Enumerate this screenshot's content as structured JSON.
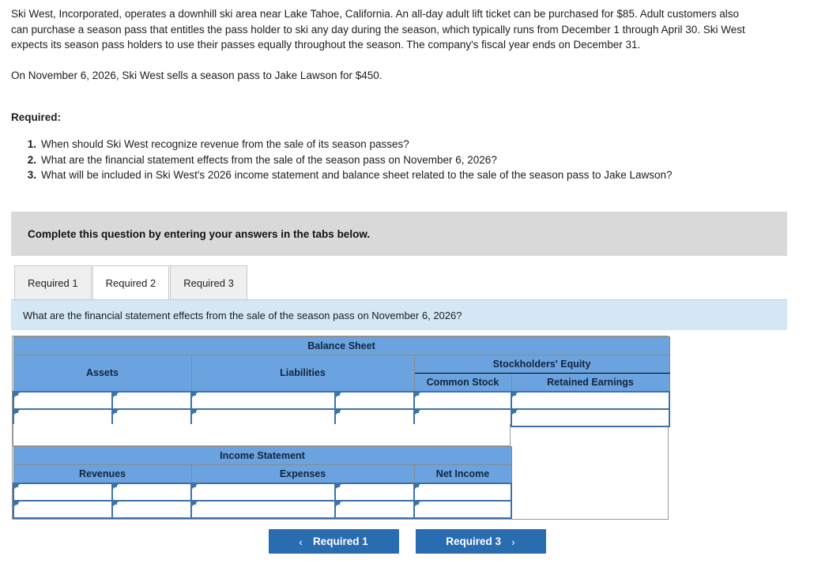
{
  "problem": {
    "paragraph1": "Ski West, Incorporated, operates a downhill ski area near Lake Tahoe, California. An all-day adult lift ticket can be purchased for $85. Adult customers also can purchase a season pass that entitles the pass holder to ski any day during the season, which typically runs from December 1 through April 30. Ski West expects its season pass holders to use their passes equally throughout the season. The company's fiscal year ends on December 31.",
    "paragraph2": "On November 6, 2026, Ski West sells a season pass to Jake Lawson for $450.",
    "required_label": "Required:",
    "requirements": [
      {
        "num": "1.",
        "text": "When should Ski West recognize revenue from the sale of its season passes?"
      },
      {
        "num": "2.",
        "text": "What are the financial statement effects from the sale of the season pass on November 6, 2026?"
      },
      {
        "num": "3.",
        "text": "What will be included in Ski West's 2026 income statement and balance sheet related to the sale of the season pass to Jake Lawson?"
      }
    ]
  },
  "instruction_bar": {
    "text": "Complete this question by entering your answers in the tabs below."
  },
  "tabs": [
    {
      "label": "Required 1",
      "active": false
    },
    {
      "label": "Required 2",
      "active": true
    },
    {
      "label": "Required 3",
      "active": false
    }
  ],
  "question_banner": {
    "text": "What are the financial statement effects from the sale of the season pass on November 6, 2026?"
  },
  "worksheet": {
    "balance_sheet": {
      "title": "Balance Sheet",
      "columns": [
        "Assets",
        "Liabilities",
        "Stockholders' Equity"
      ],
      "equity_subcolumns": [
        "Common Stock",
        "Retained Earnings"
      ],
      "rows": [
        {
          "assets_label": "",
          "assets_amount": "",
          "liabilities_label": "",
          "liabilities_amount": "",
          "common_stock": "",
          "retained_earnings": ""
        },
        {
          "assets_label": "",
          "assets_amount": "",
          "liabilities_label": "",
          "liabilities_amount": "",
          "common_stock": "",
          "retained_earnings": ""
        }
      ]
    },
    "income_statement": {
      "title": "Income Statement",
      "columns": [
        "Revenues",
        "Expenses",
        "Net Income"
      ],
      "rows": [
        {
          "revenues_label": "",
          "revenues_amount": "",
          "expenses_label": "",
          "expenses_amount": "",
          "net_income": ""
        },
        {
          "revenues_label": "",
          "revenues_amount": "",
          "expenses_label": "",
          "expenses_amount": "",
          "net_income": ""
        }
      ]
    }
  },
  "nav": {
    "prev_label": "Required 1",
    "next_label": "Required 3",
    "prev_chevron": "‹",
    "next_chevron": "›"
  },
  "colors": {
    "header_blue": "#6aa3e0",
    "banner_blue": "#d4e7f5",
    "instruction_gray": "#d9d9d9",
    "button_blue": "#2a6cb0",
    "input_border_blue": "#3d72a8"
  }
}
